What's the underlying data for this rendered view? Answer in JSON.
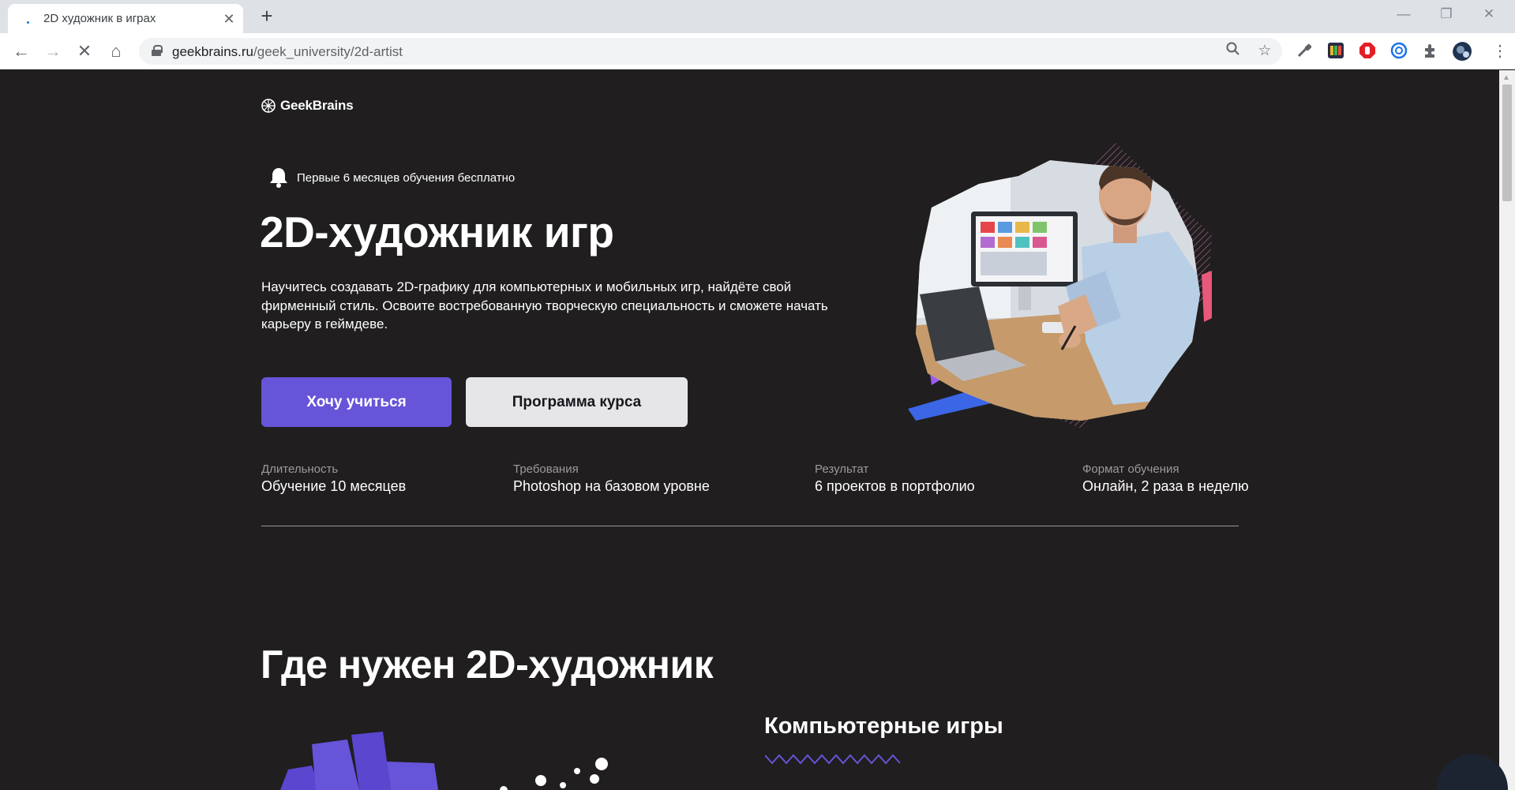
{
  "browser": {
    "tab_title": "2D художник в играх",
    "url_host": "geekbrains.ru",
    "url_path": "/geek_university/2d-artist"
  },
  "page": {
    "logo_text": "GeekBrains",
    "promo_text": "Первые 6 месяцев обучения бесплатно",
    "hero_title": "2D-художник игр",
    "hero_description": "Научитесь создавать 2D-графику для компьютерных и мобильных игр, найдёте свой фирменный стиль. Освоите востребованную творческую специальность и сможете начать карьеру в геймдеве.",
    "cta_primary": "Хочу учиться",
    "cta_secondary": "Программа курса",
    "facts": [
      {
        "label": "Длительность",
        "value": "Обучение 10 месяцев"
      },
      {
        "label": "Требования",
        "value": "Photoshop на базовом уровне"
      },
      {
        "label": "Результат",
        "value": "6 проектов в портфолио"
      },
      {
        "label": "Формат обучения",
        "value": "Онлайн, 2 раза в неделю"
      }
    ],
    "section_title": "Где нужен 2D-художник",
    "section_subtitle": "Компьютерные игры"
  },
  "colors": {
    "page_bg": "#201e1e",
    "accent": "#6654d9",
    "secondary_button": "#e6e6e9"
  }
}
